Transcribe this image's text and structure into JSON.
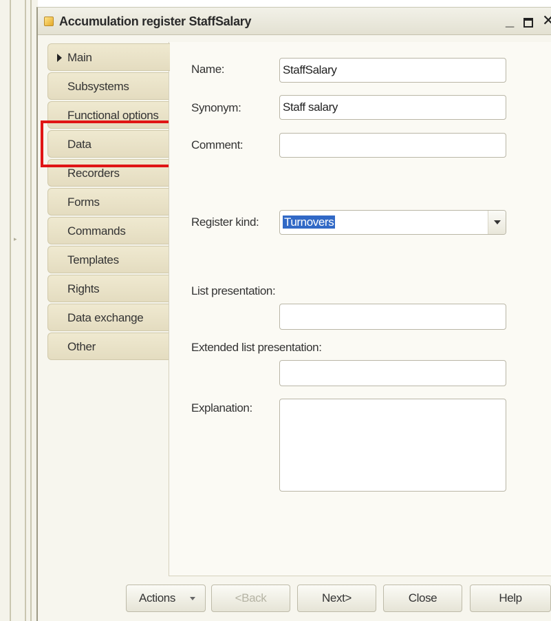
{
  "window": {
    "title": "Accumulation register StaffSalary"
  },
  "tabs": [
    {
      "label": "Main",
      "active": true
    },
    {
      "label": "Subsystems",
      "active": false
    },
    {
      "label": "Functional options",
      "active": false
    },
    {
      "label": "Data",
      "active": false,
      "highlighted": true
    },
    {
      "label": "Recorders",
      "active": false
    },
    {
      "label": "Forms",
      "active": false
    },
    {
      "label": "Commands",
      "active": false
    },
    {
      "label": "Templates",
      "active": false
    },
    {
      "label": "Rights",
      "active": false
    },
    {
      "label": "Data exchange",
      "active": false
    },
    {
      "label": "Other",
      "active": false
    }
  ],
  "form": {
    "name_label": "Name:",
    "name_value": "StaffSalary",
    "synonym_label": "Synonym:",
    "synonym_value": "Staff salary",
    "comment_label": "Comment:",
    "comment_value": "",
    "register_kind_label": "Register kind:",
    "register_kind_value": "Turnovers",
    "list_presentation_label": "List presentation:",
    "list_presentation_value": "",
    "extended_list_presentation_label": "Extended list presentation:",
    "extended_list_presentation_value": "",
    "explanation_label": "Explanation:",
    "explanation_value": ""
  },
  "buttons": {
    "actions": "Actions",
    "back": "<Back",
    "next": "Next>",
    "close": "Close",
    "help": "Help"
  },
  "colors": {
    "highlight": "#e01515",
    "selection": "#3169c6"
  }
}
